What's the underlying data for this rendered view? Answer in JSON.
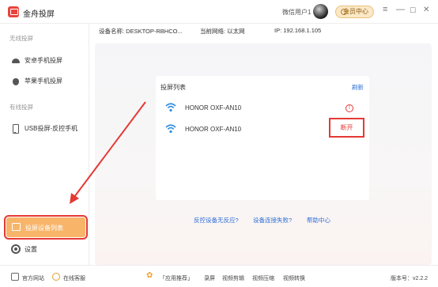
{
  "title_bar": {
    "app_name": "金舟投屏",
    "user_name": "微信用户1",
    "vip_label": "会员中心",
    "minimize_glyph": "—",
    "close_glyph": "✕",
    "menu_glyph": "≡",
    "restore_glyph": "☐"
  },
  "info_bar": {
    "device_name": "设备名称: DESKTOP-RBHCO...",
    "network": "当前网络: 以太网",
    "ip": "IP: 192.168.1.105"
  },
  "sidebar": {
    "wireless_section": "无线投屏",
    "android_item": "安卓手机投屏",
    "apple_item": "苹果手机投屏",
    "wired_section": "有线投屏",
    "usb_item": "USB投屏-反控手机",
    "device_list_item": "投屏设备列表",
    "settings_item": "设置"
  },
  "card": {
    "title": "投屏列表",
    "refresh": "刷新",
    "devices": [
      {
        "name": "HONOR OXF-AN10",
        "status_icon": "warning-icon"
      },
      {
        "name": "HONOR OXF-AN10",
        "action": "断开"
      }
    ]
  },
  "help": {
    "link1": "反控设备无反应?",
    "link2": "设备连接失败?",
    "link3": "帮助中心"
  },
  "bottom_bar": {
    "website": "官方网站",
    "support": "在线客服",
    "apps_recommend": "「应用推荐」",
    "record": "录屏",
    "video_edit": "视频剪辑",
    "video_compress": "视频压缩",
    "video_convert": "视频转换",
    "version": "版本号：v2.2.2"
  },
  "colors": {
    "accent": "#f8b56a",
    "highlight_box": "#e53935",
    "link": "#2f6fd6",
    "wifi": "#2f8ee0"
  }
}
